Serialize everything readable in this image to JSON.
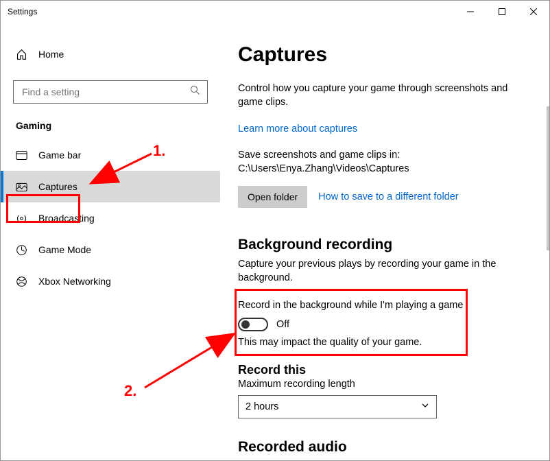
{
  "window": {
    "title": "Settings"
  },
  "sidebar": {
    "home_label": "Home",
    "search_placeholder": "Find a setting",
    "group_label": "Gaming",
    "items": [
      {
        "label": "Game bar",
        "icon": "game-bar-icon"
      },
      {
        "label": "Captures",
        "icon": "captures-icon",
        "selected": true
      },
      {
        "label": "Broadcasting",
        "icon": "broadcasting-icon"
      },
      {
        "label": "Game Mode",
        "icon": "game-mode-icon"
      },
      {
        "label": "Xbox Networking",
        "icon": "xbox-networking-icon"
      }
    ]
  },
  "content": {
    "page_title": "Captures",
    "intro": "Control how you capture your game through screenshots and game clips.",
    "learn_more": "Learn more about captures",
    "save_path_text": "Save screenshots and game clips in: C:\\Users\\Enya.Zhang\\Videos\\Captures",
    "open_folder_label": "Open folder",
    "save_elsewhere_link": "How to save to a different folder",
    "background_recording": {
      "heading": "Background recording",
      "sub": "Capture your previous plays by recording your game in the background.",
      "toggle_label": "Record in the background while I'm playing a game",
      "toggle_state": "Off",
      "toggle_on": false,
      "note": "This may impact the quality of your game."
    },
    "record_this": {
      "heading": "Record this",
      "field_label": "Maximum recording length",
      "selected": "2 hours"
    },
    "recorded_audio_heading": "Recorded audio"
  },
  "annotations": {
    "step1": "1.",
    "step2": "2."
  }
}
